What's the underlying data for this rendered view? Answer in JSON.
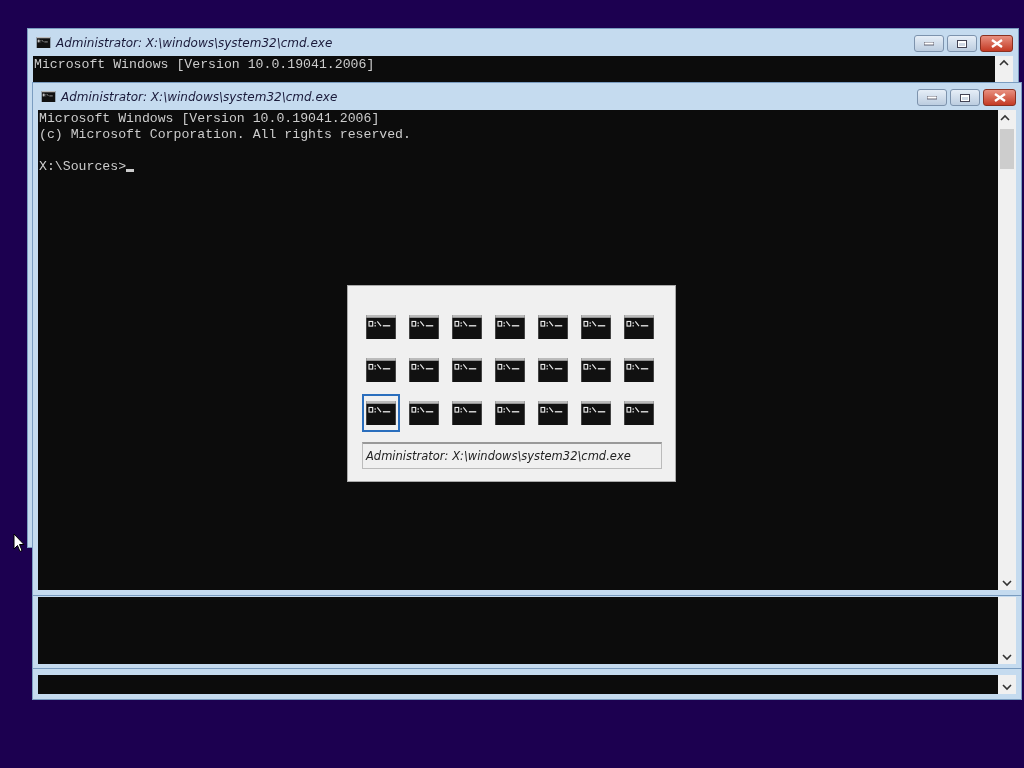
{
  "windows": [
    {
      "title": "Administrator: X:\\windows\\system32\\cmd.exe",
      "lines": [
        "Microsoft Windows [Version 10.0.19041.2006]"
      ]
    },
    {
      "title": "Administrator: X:\\windows\\system32\\cmd.exe",
      "lines": [
        "Microsoft Windows [Version 10.0.19041.2006]",
        "(c) Microsoft Corporation. All rights reserved."
      ],
      "prompt": "X:\\Sources>",
      "cursor": true
    }
  ],
  "lower_windows": [
    {
      "kind": "console"
    },
    {
      "kind": "console"
    }
  ],
  "switcher": {
    "items": [
      {
        "selected": false
      },
      {
        "selected": false
      },
      {
        "selected": false
      },
      {
        "selected": false
      },
      {
        "selected": false
      },
      {
        "selected": false
      },
      {
        "selected": false
      },
      {
        "selected": false
      },
      {
        "selected": false
      },
      {
        "selected": false
      },
      {
        "selected": false
      },
      {
        "selected": false
      },
      {
        "selected": false
      },
      {
        "selected": false
      },
      {
        "selected": true
      },
      {
        "selected": false
      },
      {
        "selected": false
      },
      {
        "selected": false
      },
      {
        "selected": false
      },
      {
        "selected": false
      },
      {
        "selected": false
      }
    ],
    "caption": "Administrator: X:\\windows\\system32\\cmd.exe"
  }
}
